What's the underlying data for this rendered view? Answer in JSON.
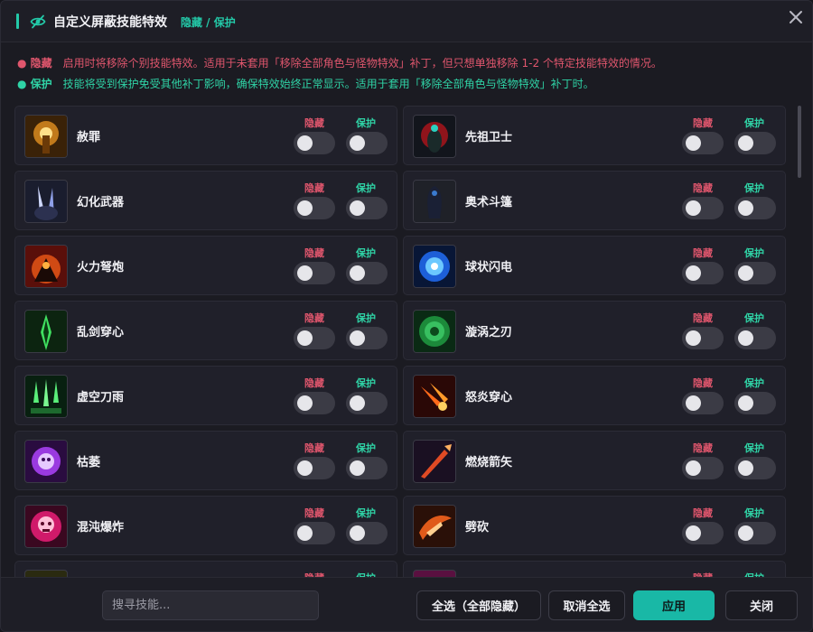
{
  "header": {
    "title": "自定义屏蔽技能特效",
    "subtitle": "隐藏 / 保护"
  },
  "notes": {
    "hide": {
      "tag": "● 隐藏",
      "text": "启用时将移除个别技能特效。适用于未套用「移除全部角色与怪物特效」补丁，但只想单独移除 1-2 个特定技能特效的情况。"
    },
    "protect": {
      "tag": "● 保护",
      "text": "技能将受到保护免受其他补丁影响，确保特效始终正常显示。适用于套用「移除全部角色与怪物特效」补丁时。"
    }
  },
  "labels": {
    "hide": "隐藏",
    "protect": "保护"
  },
  "colors": {
    "accent": "#23c9a8",
    "hide": "#e0566d",
    "protect": "#2fd3a6"
  },
  "skills": [
    {
      "name": "赦罪",
      "icon": "absolution-icon",
      "hide": false,
      "protect": false
    },
    {
      "name": "先祖卫士",
      "icon": "ancestral-guardian-icon",
      "hide": false,
      "protect": false
    },
    {
      "name": "幻化武器",
      "icon": "phantom-weapon-icon",
      "hide": false,
      "protect": false
    },
    {
      "name": "奥术斗篷",
      "icon": "arcane-cloak-icon",
      "hide": false,
      "protect": false
    },
    {
      "name": "火力弩炮",
      "icon": "ballista-icon",
      "hide": false,
      "protect": false
    },
    {
      "name": "球状闪电",
      "icon": "ball-lightning-icon",
      "hide": false,
      "protect": false
    },
    {
      "name": "乱剑穿心",
      "icon": "blade-flurry-icon",
      "hide": false,
      "protect": false
    },
    {
      "name": "漩涡之刃",
      "icon": "vortex-blade-icon",
      "hide": false,
      "protect": false
    },
    {
      "name": "虚空刀雨",
      "icon": "void-blade-rain-icon",
      "hide": false,
      "protect": false
    },
    {
      "name": "怒炎穿心",
      "icon": "blazing-pierce-icon",
      "hide": false,
      "protect": false
    },
    {
      "name": "枯萎",
      "icon": "blight-icon",
      "hide": false,
      "protect": false
    },
    {
      "name": "燃烧箭矢",
      "icon": "burning-arrow-icon",
      "hide": false,
      "protect": false
    },
    {
      "name": "混沌爆炸",
      "icon": "chaos-blast-icon",
      "hide": false,
      "protect": false
    },
    {
      "name": "劈砍",
      "icon": "cleave-icon",
      "hide": false,
      "protect": false
    }
  ],
  "footer": {
    "search_placeholder": "搜寻技能...",
    "select_all": "全选（全部隐藏）",
    "deselect_all": "取消全选",
    "apply": "应用",
    "close": "关闭"
  }
}
